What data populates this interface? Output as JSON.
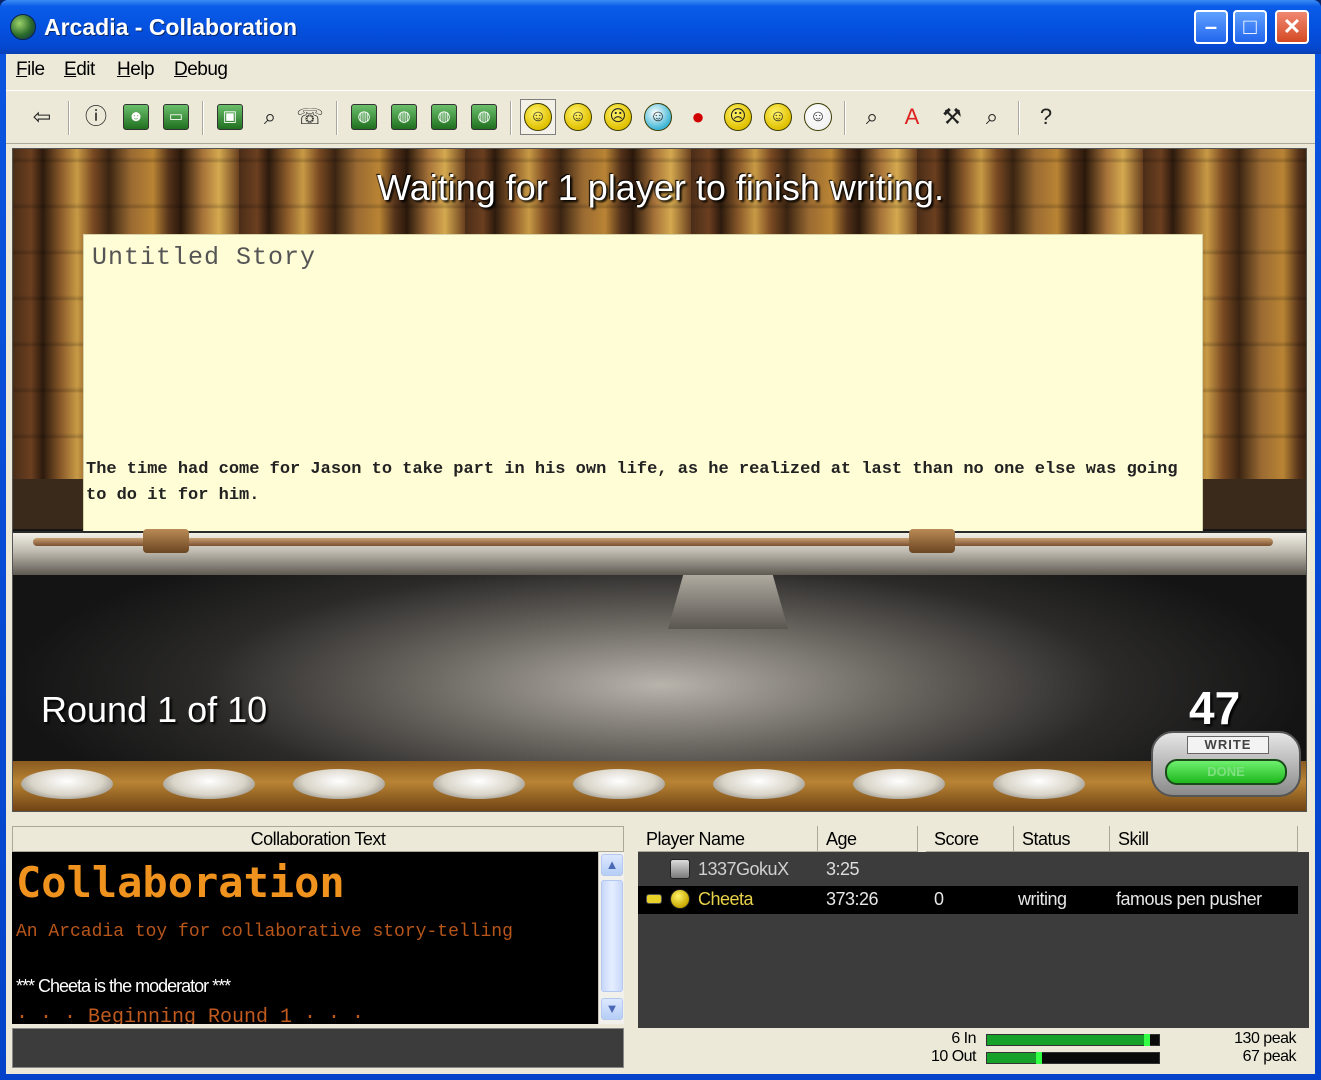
{
  "window": {
    "title": "Arcadia - Collaboration",
    "controls": {
      "minimize": "–",
      "maximize": "□",
      "close": "✕"
    }
  },
  "menu": [
    "File",
    "Edit",
    "Help",
    "Debug"
  ],
  "toolbar": {
    "groups": [
      [
        {
          "icon": "exit-icon",
          "glyph": "⇦"
        }
      ],
      [
        {
          "icon": "info-icon",
          "glyph": "ⓘ"
        },
        {
          "icon": "players-icon",
          "glyph": "☻"
        },
        {
          "icon": "chat-icon",
          "glyph": "▭"
        }
      ],
      [
        {
          "icon": "screen-icon",
          "glyph": "▣"
        },
        {
          "icon": "search-players-icon",
          "glyph": "⌕"
        },
        {
          "icon": "speech-icon",
          "glyph": "☏"
        }
      ],
      [
        {
          "icon": "globe-icon",
          "glyph": "◍"
        },
        {
          "icon": "globe-chat-icon",
          "glyph": "◍"
        },
        {
          "icon": "globe-user-icon",
          "glyph": "◍"
        },
        {
          "icon": "globe-group-icon",
          "glyph": "◍"
        }
      ],
      [
        {
          "icon": "smile-face-icon",
          "glyph": "☺",
          "pressed": true
        },
        {
          "icon": "neutral-face-icon",
          "glyph": "☺"
        },
        {
          "icon": "sad-face-icon",
          "glyph": "☹"
        },
        {
          "icon": "cold-face-icon",
          "glyph": "☺",
          "color": "#3fb6d6"
        },
        {
          "icon": "red-dot-icon",
          "glyph": "●",
          "color": "#d10000"
        },
        {
          "icon": "angry-face-icon",
          "glyph": "☹"
        },
        {
          "icon": "wink-face-icon",
          "glyph": "☺"
        },
        {
          "icon": "blank-face-icon",
          "glyph": "☺",
          "color": "#f2f2f2"
        }
      ],
      [
        {
          "icon": "search-user-icon",
          "glyph": "⌕"
        },
        {
          "icon": "font-icon",
          "glyph": "A",
          "color": "#d22"
        },
        {
          "icon": "tools-icon",
          "glyph": "⚒"
        },
        {
          "icon": "find-icon",
          "glyph": "⌕"
        }
      ],
      [
        {
          "icon": "help-icon",
          "glyph": "?"
        }
      ]
    ]
  },
  "stage": {
    "waiting_message": "Waiting for 1 player to finish writing.",
    "story_title": "Untitled Story",
    "story_text": "The time had come for Jason to take part in his own life, as he realized at last than no one else was going to do it for him.",
    "round_text": "Round 1 of 10",
    "timer": "47",
    "write_label": "WRITE",
    "done_label": "DONE"
  },
  "chat": {
    "header": "Collaboration Text",
    "big_title": "Collaboration",
    "subtitle": "An Arcadia toy for collaborative story-telling",
    "moderator_line": "*** Cheeta is the moderator ***",
    "round_line": "· · · Beginning Round 1 · · ·",
    "scroll_up": "▲",
    "scroll_down": "▼"
  },
  "players": {
    "columns": [
      "Player Name",
      "Age",
      "Score",
      "Status",
      "Skill"
    ],
    "rows": [
      {
        "name": "1337GokuX",
        "age": "3:25",
        "score": "",
        "status": "",
        "skill": "",
        "selected": false,
        "moderator": false,
        "icon": "robot-icon"
      },
      {
        "name": "Cheeta",
        "age": "373:26",
        "score": "0",
        "status": "writing",
        "skill": "famous pen pusher",
        "selected": true,
        "moderator": true,
        "icon": "smiley-icon"
      }
    ]
  },
  "network": {
    "in_label": "6 In",
    "out_label": "10 Out",
    "in_peak": "130 peak",
    "out_peak": "67 peak",
    "in_level": 0.95,
    "out_level": 0.32
  }
}
